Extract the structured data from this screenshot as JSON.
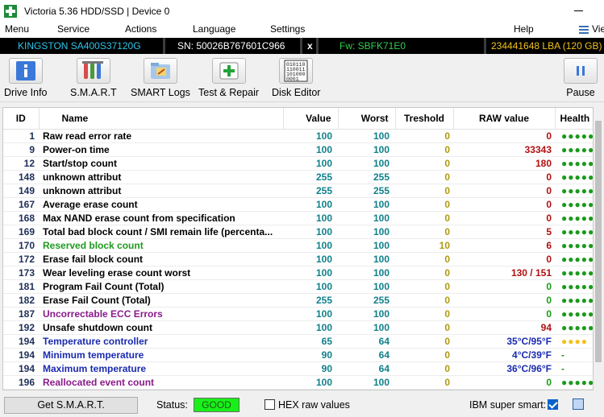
{
  "window": {
    "title": "Victoria 5.36 HDD/SSD | Device 0"
  },
  "menu": {
    "items": [
      "Menu",
      "Service",
      "Actions",
      "Language",
      "Settings",
      "Help"
    ],
    "view_label": "Vie"
  },
  "device": {
    "model": "KINGSTON SA400S37120G",
    "serial": "SN: 50026B767601C966",
    "close_mark": "x",
    "firmware": "Fw: SBFK71E0",
    "capacity": "234441648 LBA (120 GB)"
  },
  "toolbar": {
    "buttons": [
      {
        "label": "Drive Info",
        "icon": "info-icon"
      },
      {
        "label": "S.M.A.R.T",
        "icon": "test-tubes-icon"
      },
      {
        "label": "SMART Logs",
        "icon": "logs-folder-icon"
      },
      {
        "label": "Test & Repair",
        "icon": "plus-kit-icon"
      },
      {
        "label": "Disk Editor",
        "icon": "binary-editor-icon"
      }
    ],
    "pause_label": "Pause",
    "binary_icon_text": [
      "010110",
      "110011",
      "101000",
      "0001"
    ]
  },
  "table": {
    "headers": {
      "id": "ID",
      "name": "Name",
      "value": "Value",
      "worst": "Worst",
      "treshold": "Treshold",
      "raw": "RAW value",
      "health": "Health"
    },
    "rows": [
      {
        "id": "1",
        "name": "Raw read error rate",
        "value": "100",
        "worst": "100",
        "treshold": "0",
        "raw": "0",
        "health": "●●●●●",
        "name_color": "#000000",
        "raw_color": "#b01010",
        "health_color": "#1a9a1a"
      },
      {
        "id": "9",
        "name": "Power-on time",
        "value": "100",
        "worst": "100",
        "treshold": "0",
        "raw": "33343",
        "health": "●●●●●",
        "name_color": "#000000",
        "raw_color": "#b01010",
        "health_color": "#1a9a1a"
      },
      {
        "id": "12",
        "name": "Start/stop count",
        "value": "100",
        "worst": "100",
        "treshold": "0",
        "raw": "180",
        "health": "●●●●●",
        "name_color": "#000000",
        "raw_color": "#b01010",
        "health_color": "#1a9a1a"
      },
      {
        "id": "148",
        "name": "unknown attribut",
        "value": "255",
        "worst": "255",
        "treshold": "0",
        "raw": "0",
        "health": "●●●●●",
        "name_color": "#000000",
        "raw_color": "#b01010",
        "health_color": "#1a9a1a"
      },
      {
        "id": "149",
        "name": "unknown attribut",
        "value": "255",
        "worst": "255",
        "treshold": "0",
        "raw": "0",
        "health": "●●●●●",
        "name_color": "#000000",
        "raw_color": "#b01010",
        "health_color": "#1a9a1a"
      },
      {
        "id": "167",
        "name": "Average erase count",
        "value": "100",
        "worst": "100",
        "treshold": "0",
        "raw": "0",
        "health": "●●●●●",
        "name_color": "#000000",
        "raw_color": "#b01010",
        "health_color": "#1a9a1a"
      },
      {
        "id": "168",
        "name": "Max NAND erase count from specification",
        "value": "100",
        "worst": "100",
        "treshold": "0",
        "raw": "0",
        "health": "●●●●●",
        "name_color": "#000000",
        "raw_color": "#b01010",
        "health_color": "#1a9a1a"
      },
      {
        "id": "169",
        "name": "Total bad block count / SMI remain life (percenta...",
        "value": "100",
        "worst": "100",
        "treshold": "0",
        "raw": "5",
        "health": "●●●●●",
        "name_color": "#000000",
        "raw_color": "#b01010",
        "health_color": "#1a9a1a"
      },
      {
        "id": "170",
        "name": "Reserved block count",
        "value": "100",
        "worst": "100",
        "treshold": "10",
        "raw": "6",
        "health": "●●●●●",
        "name_color": "#1f9a1f",
        "raw_color": "#b01010",
        "health_color": "#1a9a1a"
      },
      {
        "id": "172",
        "name": "Erase fail block count",
        "value": "100",
        "worst": "100",
        "treshold": "0",
        "raw": "0",
        "health": "●●●●●",
        "name_color": "#000000",
        "raw_color": "#b01010",
        "health_color": "#1a9a1a"
      },
      {
        "id": "173",
        "name": "Wear leveling erase count worst",
        "value": "100",
        "worst": "100",
        "treshold": "0",
        "raw": "130 / 151",
        "health": "●●●●●",
        "name_color": "#000000",
        "raw_color": "#b01010",
        "health_color": "#1a9a1a"
      },
      {
        "id": "181",
        "name": "Program Fail Count (Total)",
        "value": "100",
        "worst": "100",
        "treshold": "0",
        "raw": "0",
        "health": "●●●●●",
        "name_color": "#000000",
        "raw_color": "#1a9a1a",
        "health_color": "#1a9a1a"
      },
      {
        "id": "182",
        "name": "Erase Fail Count (Total)",
        "value": "255",
        "worst": "255",
        "treshold": "0",
        "raw": "0",
        "health": "●●●●●",
        "name_color": "#000000",
        "raw_color": "#1a9a1a",
        "health_color": "#1a9a1a"
      },
      {
        "id": "187",
        "name": "Uncorrectable ECC Errors",
        "value": "100",
        "worst": "100",
        "treshold": "0",
        "raw": "0",
        "health": "●●●●●",
        "name_color": "#8a1a8a",
        "raw_color": "#1a9a1a",
        "health_color": "#1a9a1a"
      },
      {
        "id": "192",
        "name": "Unsafe shutdown count",
        "value": "100",
        "worst": "100",
        "treshold": "0",
        "raw": "94",
        "health": "●●●●●",
        "name_color": "#000000",
        "raw_color": "#b01010",
        "health_color": "#1a9a1a"
      },
      {
        "id": "194",
        "name": "Temperature controller",
        "value": "65",
        "worst": "64",
        "treshold": "0",
        "raw": "35°C/95°F",
        "health": "●●●●",
        "name_color": "#1a2ab0",
        "raw_color": "#1a2ab0",
        "health_color": "#f2c21b"
      },
      {
        "id": "194",
        "name": "Minimum temperature",
        "value": "90",
        "worst": "64",
        "treshold": "0",
        "raw": "4°C/39°F",
        "health": "-",
        "name_color": "#1a2ab0",
        "raw_color": "#1a2ab0",
        "health_color": "#1a9a1a"
      },
      {
        "id": "194",
        "name": "Maximum temperature",
        "value": "90",
        "worst": "64",
        "treshold": "0",
        "raw": "36°C/96°F",
        "health": "-",
        "name_color": "#1a2ab0",
        "raw_color": "#1a2ab0",
        "health_color": "#1a9a1a"
      },
      {
        "id": "196",
        "name": "Reallocated event count",
        "value": "100",
        "worst": "100",
        "treshold": "0",
        "raw": "0",
        "health": "●●●●●",
        "name_color": "#8a1a8a",
        "raw_color": "#1a9a1a",
        "health_color": "#1a9a1a"
      }
    ]
  },
  "status": {
    "get_smart_label": "Get S.M.A.R.T.",
    "status_label": "Status:",
    "status_value": "GOOD",
    "hex_label": "HEX raw values",
    "ibm_label": "IBM super smart:"
  },
  "colors": {
    "accent": "#0a63c9",
    "good": "#19f019",
    "device_bar": "#000000"
  }
}
